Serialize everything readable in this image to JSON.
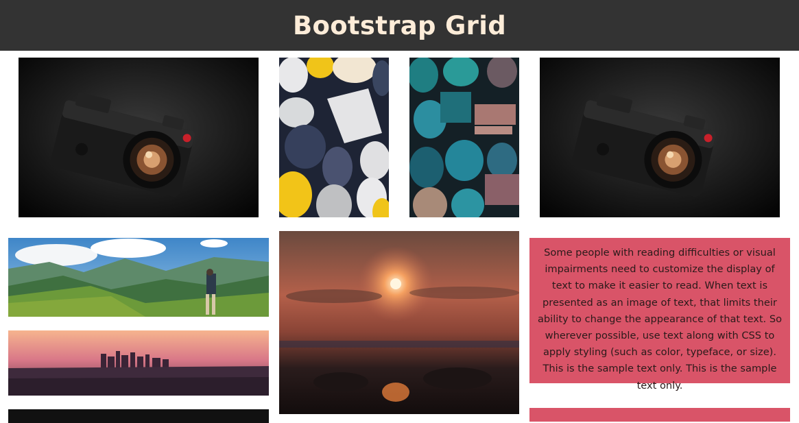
{
  "header": {
    "title": "Bootstrap Grid"
  },
  "images": {
    "camera_1": "camera photo",
    "stones_1": "colorful pebbles photo",
    "stones_2": "teal stones photo",
    "camera_2": "camera photo",
    "mountains": "mountain hiker photo",
    "city": "city skyline photo",
    "sunset": "sunset photo"
  },
  "card": {
    "text": "Some people with reading difficulties or visual impairments need to customize the display of text to make it easier to read. When text is presented as an image of text, that limits their ability to change the appearance of that text. So wherever possible, use text along with CSS to apply styling (such as color, typeface, or size). This is the sample text only. This is the sample text only."
  },
  "colors": {
    "header_bg": "#333333",
    "header_text": "#fdecd8",
    "card_bg": "#d95468"
  }
}
